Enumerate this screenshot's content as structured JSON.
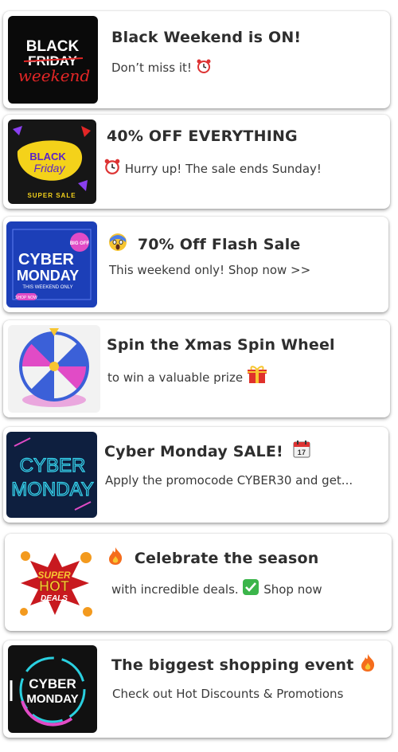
{
  "notifications": [
    {
      "thumb_text": [
        "BLACK",
        "FRIDAY",
        "weekend"
      ],
      "title": "Black Weekend is  ON!",
      "body": "Don’t miss it!",
      "body_icon": "alarm-clock-icon"
    },
    {
      "thumb_text": [
        "BLACK",
        "Friday",
        "SUPER SALE"
      ],
      "title": "40% OFF EVERYTHING",
      "body": "Hurry up! The sale ends Sunday!",
      "body_icon": "alarm-clock-icon"
    },
    {
      "thumb_text": [
        "CYBER",
        "MONDAY",
        "THIS WEEKEND ONLY",
        "SHOP NOW",
        "BIG OFF"
      ],
      "title": "70% Off Flash Sale",
      "title_icon": "screaming-face-icon",
      "body": "This weekend only! Shop now >>"
    },
    {
      "thumb_text": [],
      "title": "Spin the Xmas Spin Wheel",
      "body": "to win a valuable prize",
      "body_icon": "gift-icon"
    },
    {
      "thumb_text": [
        "CYBER",
        "MONDAY"
      ],
      "title": "Cyber Monday SALE!",
      "title_icon": "calendar-icon",
      "body": "Apply the promocode CYBER30 and get..."
    },
    {
      "thumb_text": [
        "SUPER",
        "HOT",
        "DEALS"
      ],
      "title": "Celebrate the season",
      "title_icon": "fire-icon",
      "body": "with incredible deals.",
      "body_icon": "check-mark-icon",
      "body_suffix": "Shop now"
    },
    {
      "thumb_text": [
        "CYBER",
        "MONDAY"
      ],
      "title": "The biggest shopping event",
      "title_icon": "fire-icon",
      "body": "Check out Hot Discounts & Promotions"
    }
  ]
}
